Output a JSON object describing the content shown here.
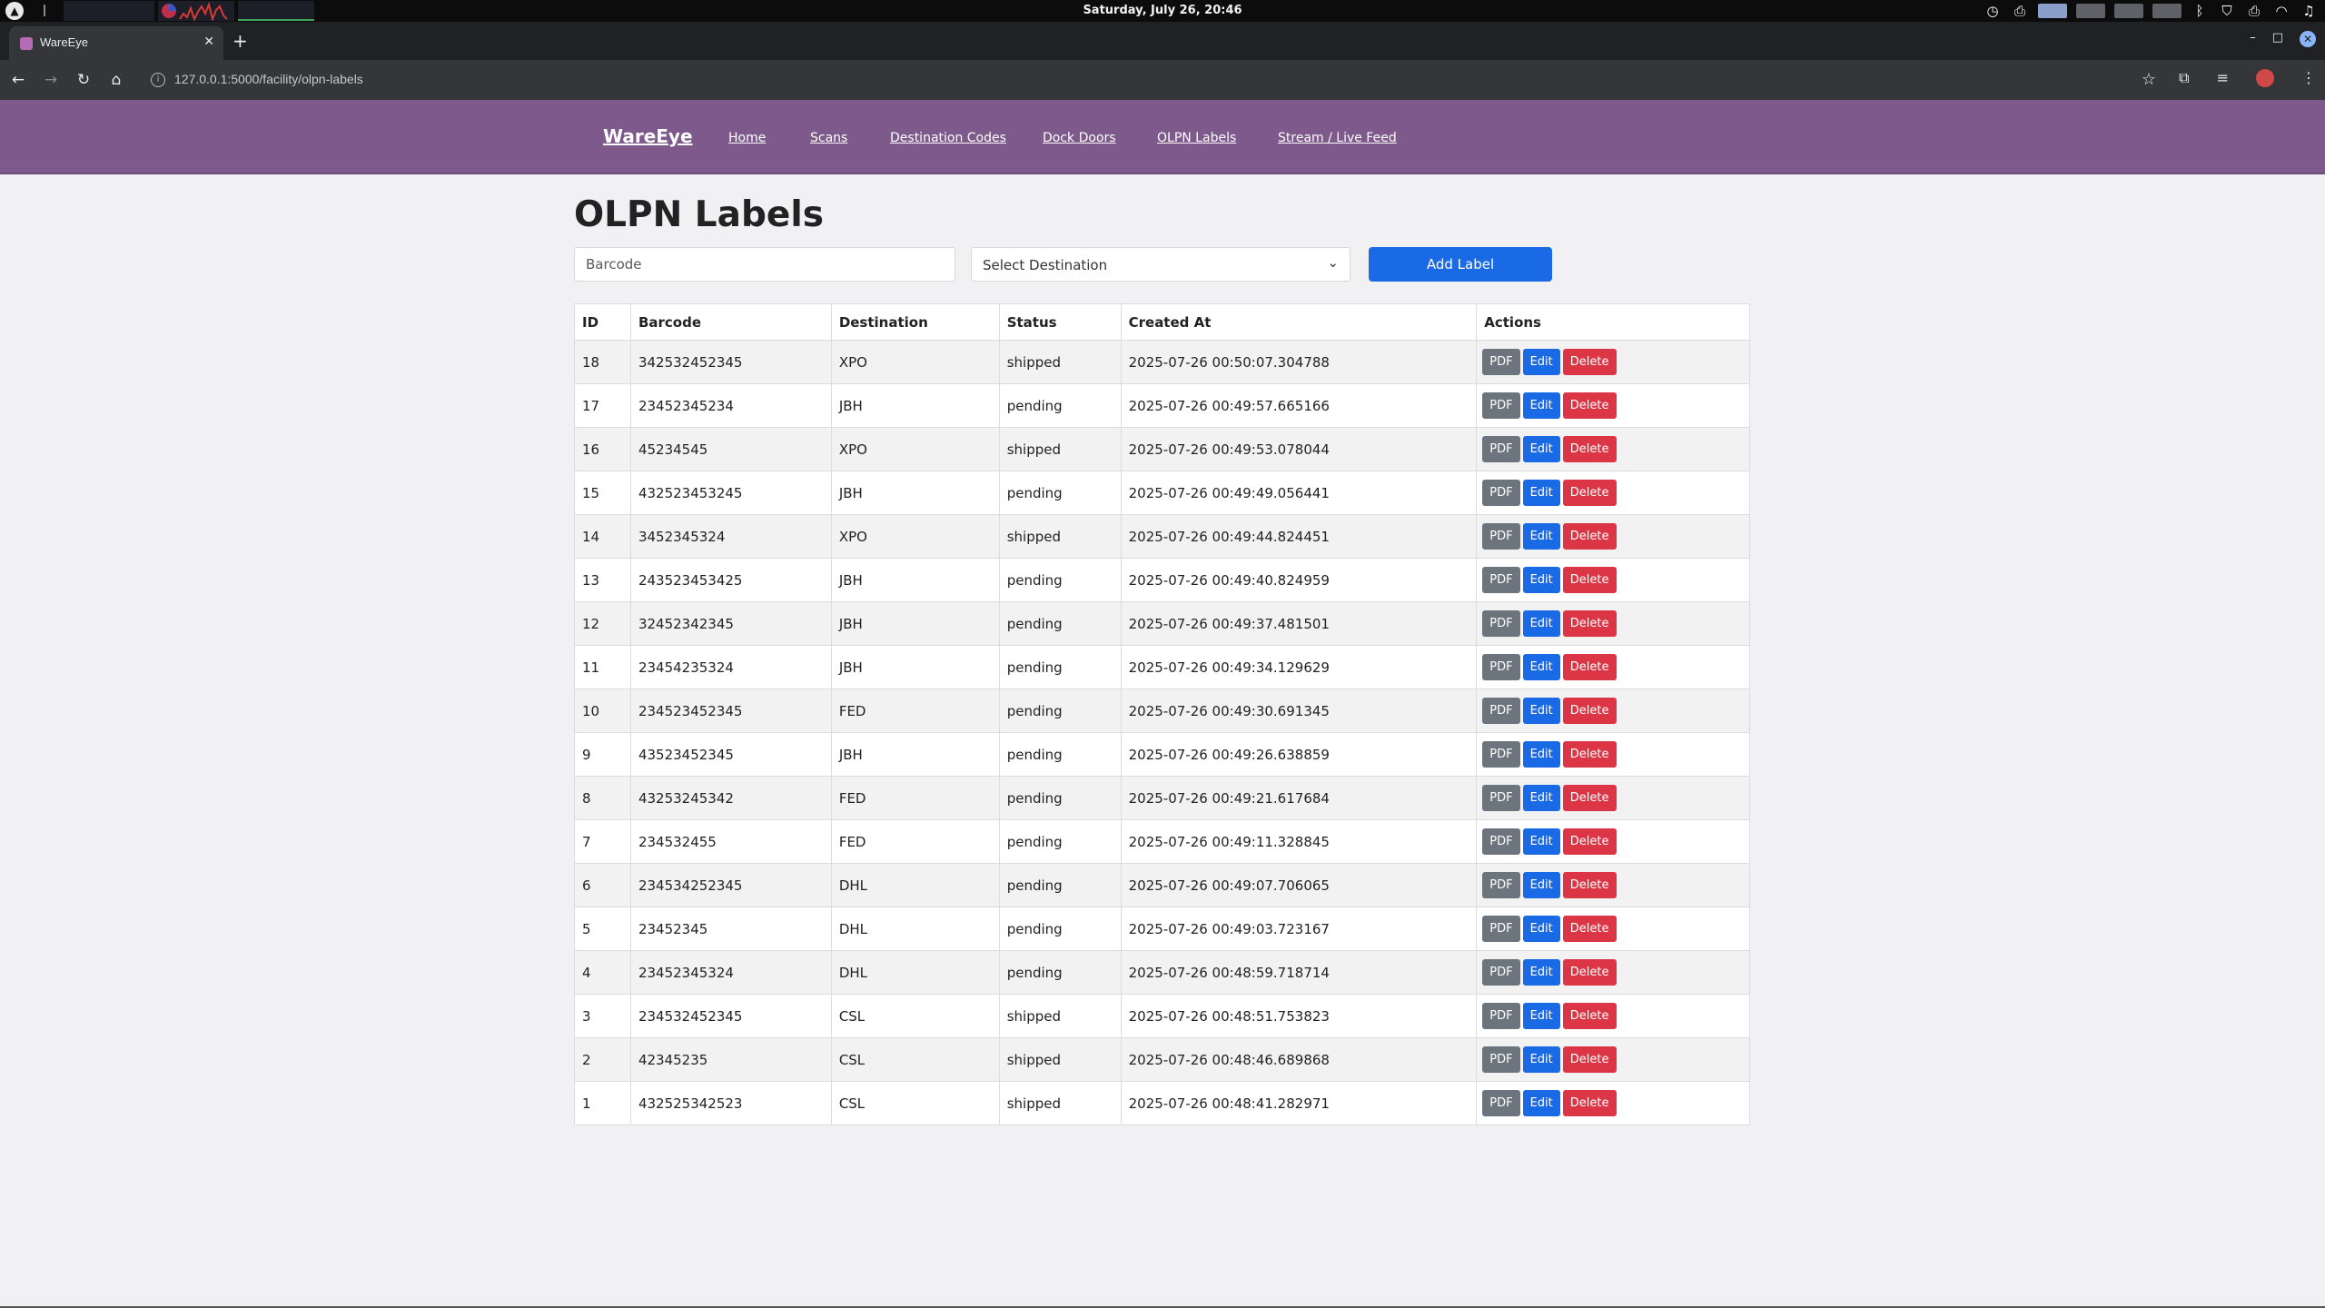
{
  "os": {
    "clock": "Saturday, July 26, 20:46"
  },
  "browser": {
    "tab_title": "WareEye",
    "url": "127.0.0.1:5000/facility/olpn-labels"
  },
  "nav": {
    "brand": "WareEye",
    "links": [
      "Home",
      "Scans",
      "Destination Codes",
      "Dock Doors",
      "OLPN Labels",
      "Stream / Live Feed"
    ]
  },
  "page": {
    "title": "OLPN Labels",
    "barcode_placeholder": "Barcode",
    "destination_selected": "Select Destination",
    "add_button": "Add Label"
  },
  "table": {
    "headers": [
      "ID",
      "Barcode",
      "Destination",
      "Status",
      "Created At",
      "Actions"
    ],
    "action_labels": {
      "pdf": "PDF",
      "edit": "Edit",
      "delete": "Delete"
    },
    "rows": [
      {
        "id": "18",
        "barcode": "342532452345",
        "destination": "XPO",
        "status": "shipped",
        "created": "2025-07-26 00:50:07.304788"
      },
      {
        "id": "17",
        "barcode": "23452345234",
        "destination": "JBH",
        "status": "pending",
        "created": "2025-07-26 00:49:57.665166"
      },
      {
        "id": "16",
        "barcode": "45234545",
        "destination": "XPO",
        "status": "shipped",
        "created": "2025-07-26 00:49:53.078044"
      },
      {
        "id": "15",
        "barcode": "432523453245",
        "destination": "JBH",
        "status": "pending",
        "created": "2025-07-26 00:49:49.056441"
      },
      {
        "id": "14",
        "barcode": "3452345324",
        "destination": "XPO",
        "status": "shipped",
        "created": "2025-07-26 00:49:44.824451"
      },
      {
        "id": "13",
        "barcode": "243523453425",
        "destination": "JBH",
        "status": "pending",
        "created": "2025-07-26 00:49:40.824959"
      },
      {
        "id": "12",
        "barcode": "32452342345",
        "destination": "JBH",
        "status": "pending",
        "created": "2025-07-26 00:49:37.481501"
      },
      {
        "id": "11",
        "barcode": "23454235324",
        "destination": "JBH",
        "status": "pending",
        "created": "2025-07-26 00:49:34.129629"
      },
      {
        "id": "10",
        "barcode": "234523452345",
        "destination": "FED",
        "status": "pending",
        "created": "2025-07-26 00:49:30.691345"
      },
      {
        "id": "9",
        "barcode": "43523452345",
        "destination": "JBH",
        "status": "pending",
        "created": "2025-07-26 00:49:26.638859"
      },
      {
        "id": "8",
        "barcode": "43253245342",
        "destination": "FED",
        "status": "pending",
        "created": "2025-07-26 00:49:21.617684"
      },
      {
        "id": "7",
        "barcode": "234532455",
        "destination": "FED",
        "status": "pending",
        "created": "2025-07-26 00:49:11.328845"
      },
      {
        "id": "6",
        "barcode": "234534252345",
        "destination": "DHL",
        "status": "pending",
        "created": "2025-07-26 00:49:07.706065"
      },
      {
        "id": "5",
        "barcode": "23452345",
        "destination": "DHL",
        "status": "pending",
        "created": "2025-07-26 00:49:03.723167"
      },
      {
        "id": "4",
        "barcode": "23452345324",
        "destination": "DHL",
        "status": "pending",
        "created": "2025-07-26 00:48:59.718714"
      },
      {
        "id": "3",
        "barcode": "234532452345",
        "destination": "CSL",
        "status": "shipped",
        "created": "2025-07-26 00:48:51.753823"
      },
      {
        "id": "2",
        "barcode": "42345235",
        "destination": "CSL",
        "status": "shipped",
        "created": "2025-07-26 00:48:46.689868"
      },
      {
        "id": "1",
        "barcode": "432525342523",
        "destination": "CSL",
        "status": "shipped",
        "created": "2025-07-26 00:48:41.282971"
      }
    ]
  },
  "colors": {
    "navbar": "#7d5a8b",
    "primary": "#1a6ae6",
    "danger": "#dc3545",
    "secondary": "#6c757d"
  },
  "icons": [
    "system-logo-icon",
    "clock-icon",
    "printer-icon",
    "bluetooth-icon",
    "wifi-icon",
    "music-icon",
    "tab-close-icon",
    "new-tab-icon",
    "back-icon",
    "forward-icon",
    "reload-icon",
    "home-icon",
    "site-info-icon",
    "bookmark-star-icon",
    "chevron-down-icon"
  ]
}
